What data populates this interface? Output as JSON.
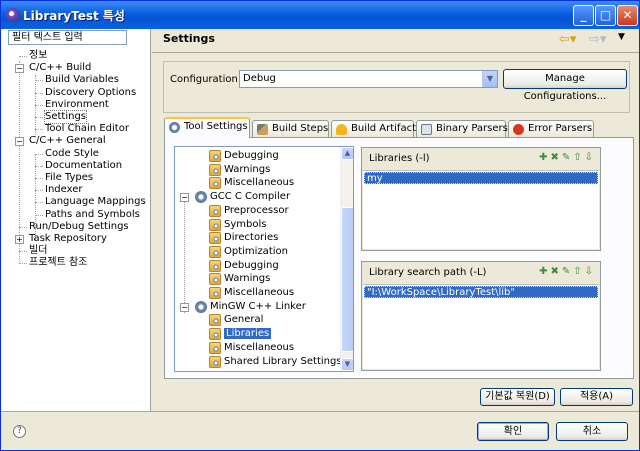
{
  "window": {
    "title": "LibraryTest 특성"
  },
  "left": {
    "filter_placeholder": "필터 텍스트 입력",
    "tree": [
      {
        "label": "정보"
      },
      {
        "label": "C/C++ Build",
        "toggle": "−"
      },
      {
        "label": "Build Variables"
      },
      {
        "label": "Discovery Options"
      },
      {
        "label": "Environment"
      },
      {
        "label": "Settings",
        "selected": true
      },
      {
        "label": "Tool Chain Editor"
      },
      {
        "label": "C/C++ General",
        "toggle": "−"
      },
      {
        "label": "Code Style"
      },
      {
        "label": "Documentation"
      },
      {
        "label": "File Types"
      },
      {
        "label": "Indexer"
      },
      {
        "label": "Language Mappings"
      },
      {
        "label": "Paths and Symbols"
      },
      {
        "label": "Run/Debug Settings"
      },
      {
        "label": "Task Repository",
        "toggle": "+"
      },
      {
        "label": "빌더"
      },
      {
        "label": "프로젝트 참조"
      }
    ]
  },
  "main": {
    "title": "Settings",
    "config_label": "Configuration:",
    "config_value": "Debug",
    "manage_button": "Manage Configurations...",
    "tabs": [
      "Tool Settings",
      "Build Steps",
      "Build Artifact",
      "Binary Parsers",
      "Error Parsers"
    ],
    "tool_tree": [
      {
        "label": "Debugging"
      },
      {
        "label": "Warnings"
      },
      {
        "label": "Miscellaneous"
      },
      {
        "label": "GCC C Compiler",
        "group": true
      },
      {
        "label": "Preprocessor"
      },
      {
        "label": "Symbols"
      },
      {
        "label": "Directories"
      },
      {
        "label": "Optimization"
      },
      {
        "label": "Debugging"
      },
      {
        "label": "Warnings"
      },
      {
        "label": "Miscellaneous"
      },
      {
        "label": "MinGW C++ Linker",
        "group": true
      },
      {
        "label": "General"
      },
      {
        "label": "Libraries",
        "selected": true
      },
      {
        "label": "Miscellaneous"
      },
      {
        "label": "Shared Library Settings"
      }
    ],
    "libraries": {
      "title": "Libraries (-l)",
      "items": [
        "my"
      ]
    },
    "lib_paths": {
      "title": "Library search path (-L)",
      "items": [
        "\"I:\\WorkSpace\\LibraryTest\\lib\""
      ]
    },
    "restore_button": "기본값 복원(D)",
    "apply_button": "적용(A)"
  },
  "footer": {
    "help": "?",
    "ok": "확인",
    "cancel": "취소"
  }
}
